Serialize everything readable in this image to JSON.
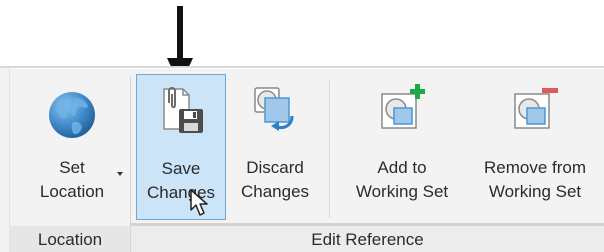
{
  "ribbon": {
    "groups": [
      {
        "label": "Location",
        "buttons": [
          {
            "label": "Set\nLocation",
            "icon": "globe-icon",
            "has_dropdown": true
          }
        ]
      },
      {
        "label": "Edit Reference",
        "buttons": [
          {
            "label": "Save\nChanges",
            "icon": "save-changes-icon",
            "state": "hover"
          },
          {
            "label": "Discard\nChanges",
            "icon": "discard-changes-icon"
          },
          {
            "label": "Add to\nWorking Set",
            "icon": "add-to-working-set-icon"
          },
          {
            "label": "Remove from\nWorking Set",
            "icon": "remove-from-working-set-icon"
          }
        ]
      }
    ]
  },
  "annotation": {
    "icon": "down-arrow-icon",
    "points_to": "Save Changes"
  },
  "colors": {
    "ribbon_bg": "#f3f3f3",
    "hover_bg": "#cce4f7",
    "hover_border": "#6fa7d6",
    "add_plus": "#1fa845",
    "remove_minus": "#e05a5a",
    "icon_blue": "#4e97d1"
  }
}
